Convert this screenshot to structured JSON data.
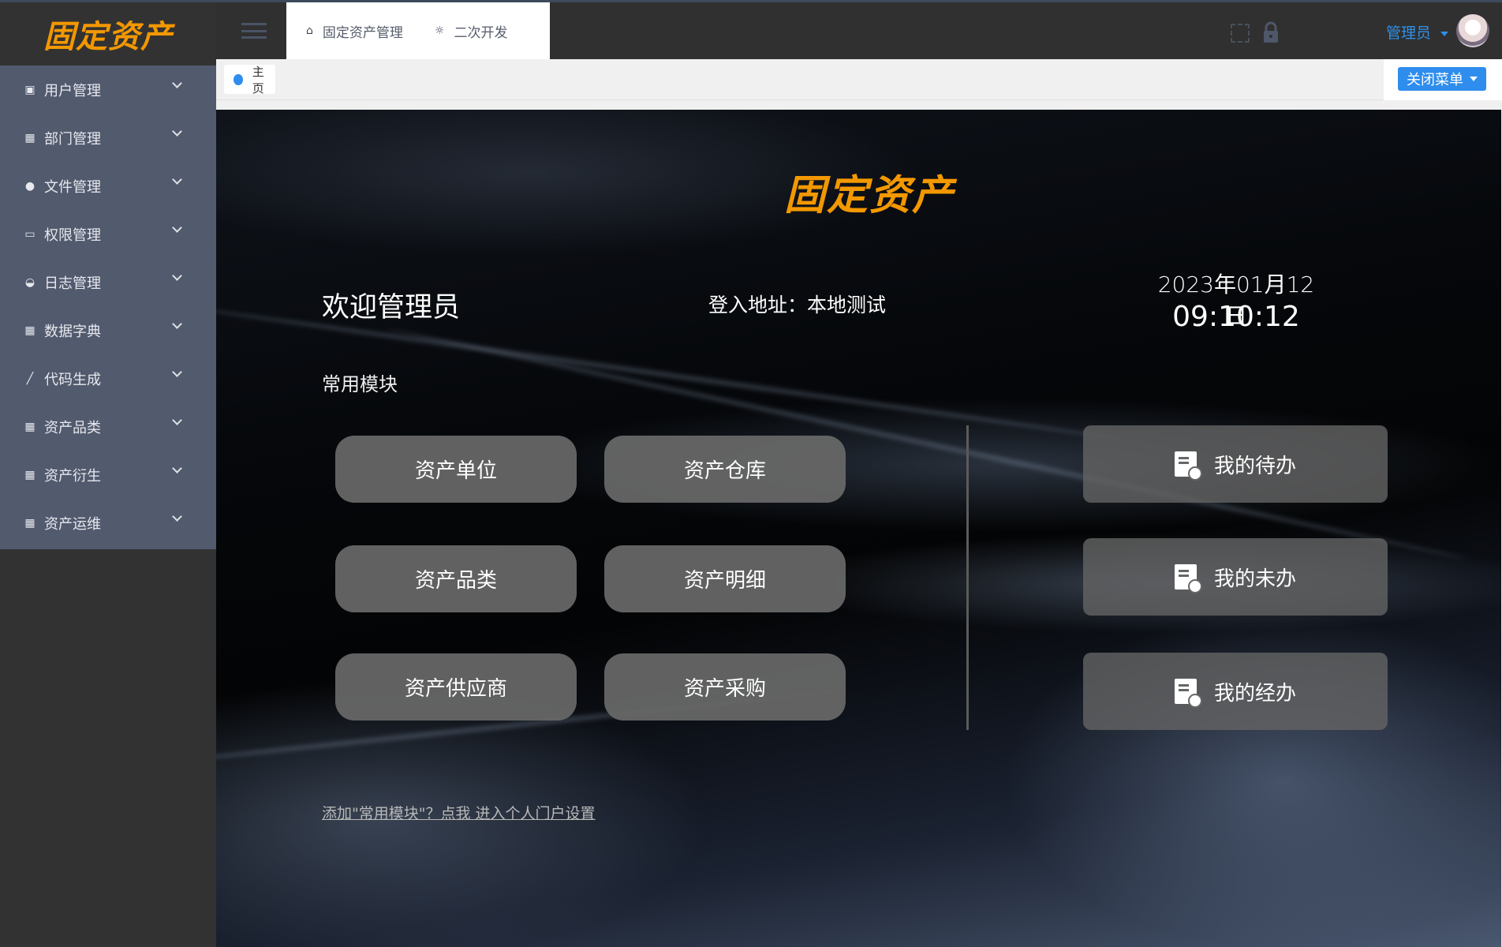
{
  "app": {
    "logo_text": "固定资产"
  },
  "sidebar": {
    "items": [
      {
        "label": "用户管理",
        "icon": "chart-icon"
      },
      {
        "label": "部门管理",
        "icon": "grid-icon"
      },
      {
        "label": "文件管理",
        "icon": "globe-icon"
      },
      {
        "label": "权限管理",
        "icon": "monitor-icon"
      },
      {
        "label": "日志管理",
        "icon": "gauge-icon"
      },
      {
        "label": "数据字典",
        "icon": "grid-icon"
      },
      {
        "label": "代码生成",
        "icon": "brush-icon"
      },
      {
        "label": "资产品类",
        "icon": "grid-icon"
      },
      {
        "label": "资产衍生",
        "icon": "grid-icon"
      },
      {
        "label": "资产运维",
        "icon": "grid-icon"
      }
    ]
  },
  "header": {
    "tabs": [
      {
        "label": "固定资产管理",
        "icon": "home-icon"
      },
      {
        "label": "二次开发",
        "icon": "lightbulb-icon"
      }
    ],
    "user": "管理员"
  },
  "breadcrumb": {
    "home": "主页",
    "close_menu": "关闭菜单"
  },
  "main": {
    "logo_text": "固定资产",
    "welcome": "欢迎管理员",
    "login_address": "登入地址：本地测试",
    "date": "2023年01月12日",
    "time": "09:10:12",
    "common_title": "常用模块",
    "modules": [
      "资产单位",
      "资产仓库",
      "资产品类",
      "资产明细",
      "资产供应商",
      "资产采购"
    ],
    "tasks": [
      "我的待办",
      "我的未办",
      "我的经办"
    ],
    "add_link": "添加\"常用模块\"？点我 进入个人门户设置"
  },
  "colors": {
    "accent": "#2e8ded",
    "logo": "#f39800",
    "sidebar": "#525a6e",
    "header": "#303030"
  }
}
